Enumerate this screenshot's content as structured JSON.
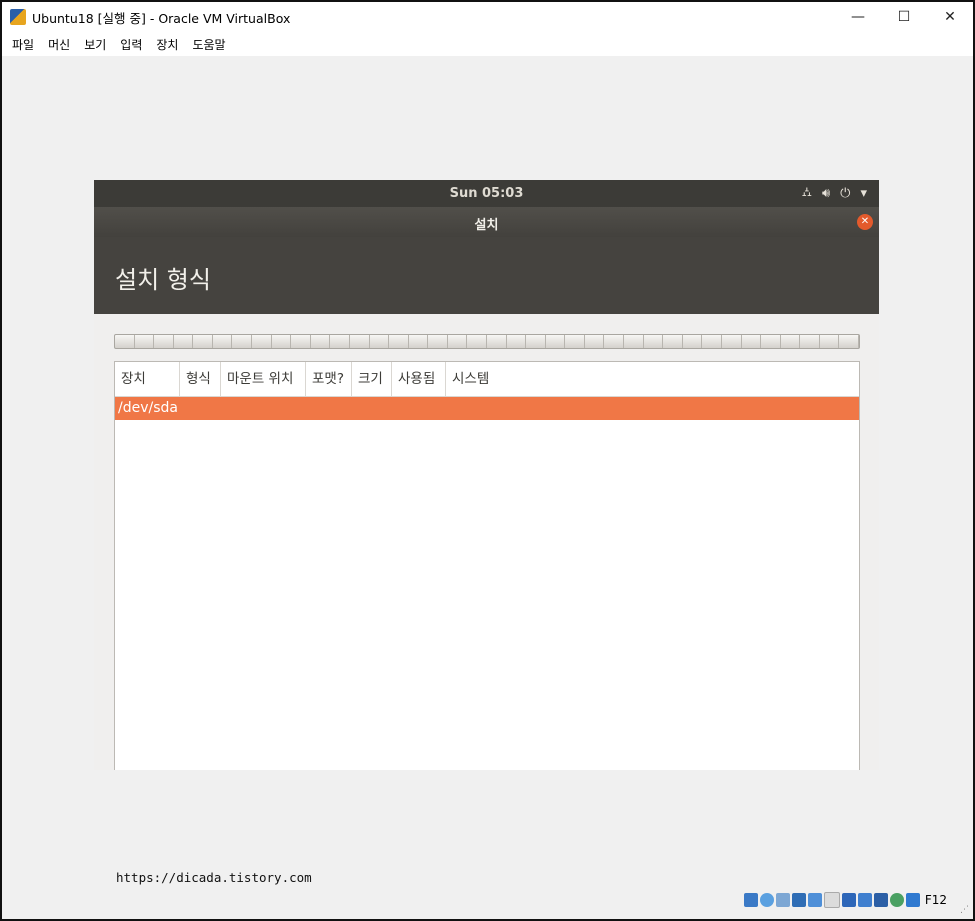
{
  "window": {
    "title": "Ubuntu18 [실행 중] - Oracle VM VirtualBox",
    "controls": {
      "minimize": "—",
      "maximize": "☐",
      "close": "✕"
    }
  },
  "menu": {
    "items": [
      "파일",
      "머신",
      "보기",
      "입력",
      "장치",
      "도움말"
    ]
  },
  "guest": {
    "topbar": {
      "clock": "Sun 05:03",
      "icons": [
        "network-icon",
        "volume-icon",
        "power-icon",
        "dropdown-arrow-icon"
      ]
    },
    "installer": {
      "title": "설치",
      "heading": "설치 형식",
      "columns": [
        "장치",
        "형식",
        "마운트 위치",
        "포맷?",
        "크기",
        "사용됨",
        "시스템"
      ],
      "rows": [
        {
          "device": "/dev/sda",
          "selected": true
        }
      ],
      "accent": "#f07746"
    }
  },
  "watermark": "https://dicada.tistory.com",
  "status": {
    "icons": [
      "hard-disk-icon",
      "optical-drive-icon",
      "audio-icon",
      "network-icon",
      "usb-icon",
      "shared-folder-icon",
      "display-icon",
      "video-capture-icon",
      "cpu-icon",
      "mouse-integration-icon",
      "keyboard-icon"
    ],
    "host_key": "F12"
  }
}
